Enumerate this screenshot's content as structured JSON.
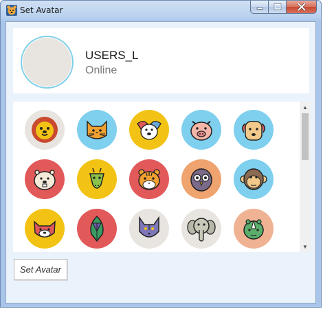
{
  "window": {
    "title": "Set Avatar"
  },
  "profile": {
    "username": "USERS_L",
    "status": "Online"
  },
  "avatars": [
    {
      "name": "lion-icon",
      "bg": "#e8e4df"
    },
    {
      "name": "cat-icon",
      "bg": "#7fcfee"
    },
    {
      "name": "dog-icon",
      "bg": "#f2c314"
    },
    {
      "name": "pig-icon",
      "bg": "#7fcfee"
    },
    {
      "name": "dog-face-icon",
      "bg": "#7fcfee"
    },
    {
      "name": "beaver-icon",
      "bg": "#e2595a"
    },
    {
      "name": "giraffe-icon",
      "bg": "#f2c314"
    },
    {
      "name": "tiger-icon",
      "bg": "#e2595a"
    },
    {
      "name": "owl-icon",
      "bg": "#efa36f"
    },
    {
      "name": "monkey-icon",
      "bg": "#7fcfee"
    },
    {
      "name": "red-panda-icon",
      "bg": "#f2c314"
    },
    {
      "name": "parrot-icon",
      "bg": "#e2595a"
    },
    {
      "name": "wolf-icon",
      "bg": "#e8e4df"
    },
    {
      "name": "elephant-icon",
      "bg": "#e8e4df"
    },
    {
      "name": "rhino-icon",
      "bg": "#efb394"
    }
  ],
  "actions": {
    "set_avatar_label": "Set Avatar"
  },
  "colors": {
    "accent": "#7fd0ea",
    "client_bg": "#eaf2fb"
  }
}
